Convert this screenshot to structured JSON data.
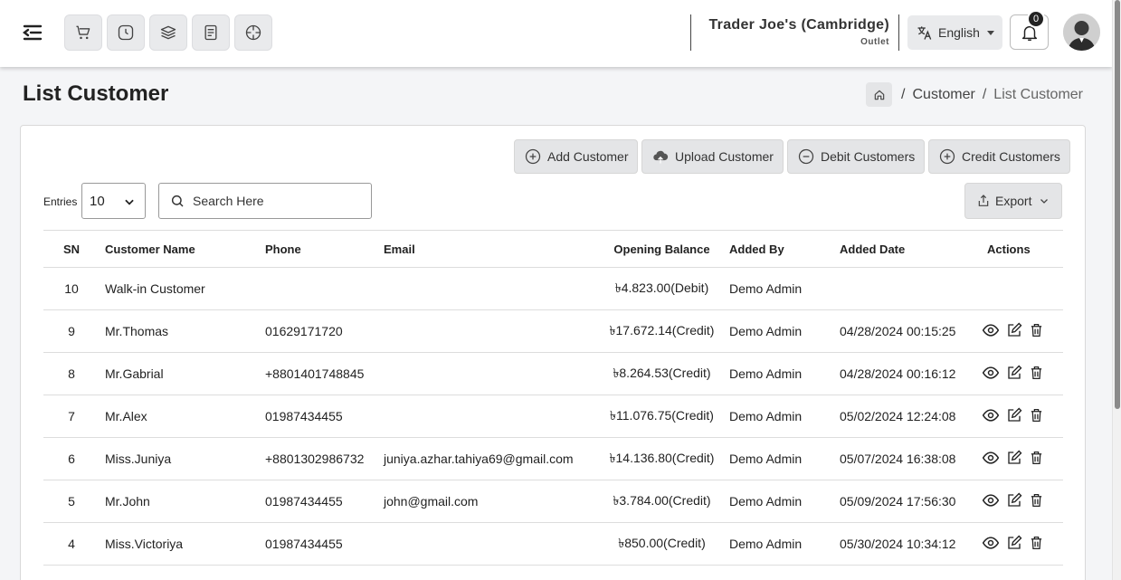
{
  "topbar": {
    "quick_icons": [
      "cart-icon",
      "clock-icon",
      "layers-icon",
      "receipt-icon",
      "dashboard-icon"
    ],
    "store_name": "Trader Joe's (Cambridge)",
    "store_type": "Outlet",
    "language": "English",
    "notification_count": "0"
  },
  "page": {
    "title": "List Customer",
    "breadcrumb": {
      "link": "Customer",
      "current": "List Customer",
      "sep1": "/",
      "sep2": "/"
    }
  },
  "actions": {
    "add": "Add Customer",
    "upload": "Upload Customer",
    "debit": "Debit Customers",
    "credit": "Credit Customers"
  },
  "filters": {
    "entries_label": "Entries",
    "entries_value": "10",
    "search_placeholder": "Search Here",
    "export_label": "Export"
  },
  "table": {
    "headers": {
      "sn": "SN",
      "name": "Customer Name",
      "phone": "Phone",
      "email": "Email",
      "balance": "Opening Balance",
      "added_by": "Added By",
      "added_date": "Added Date",
      "actions": "Actions"
    },
    "rows": [
      {
        "sn": "10",
        "name": "Walk-in Customer",
        "phone": "",
        "email": "",
        "balance": "৳4.823.00(Debit)",
        "added_by": "Demo Admin",
        "date": "",
        "actions": false
      },
      {
        "sn": "9",
        "name": "Mr.Thomas",
        "phone": "01629171720",
        "email": "",
        "balance": "৳17.672.14(Credit)",
        "added_by": "Demo Admin",
        "date": "04/28/2024 00:15:25",
        "actions": true
      },
      {
        "sn": "8",
        "name": "Mr.Gabrial",
        "phone": "+8801401748845",
        "email": "",
        "balance": "৳8.264.53(Credit)",
        "added_by": "Demo Admin",
        "date": "04/28/2024 00:16:12",
        "actions": true
      },
      {
        "sn": "7",
        "name": "Mr.Alex",
        "phone": "01987434455",
        "email": "",
        "balance": "৳11.076.75(Credit)",
        "added_by": "Demo Admin",
        "date": "05/02/2024 12:24:08",
        "actions": true
      },
      {
        "sn": "6",
        "name": "Miss.Juniya",
        "phone": "+8801302986732",
        "email": "juniya.azhar.tahiya69@gmail.com",
        "balance": "৳14.136.80(Credit)",
        "added_by": "Demo Admin",
        "date": "05/07/2024 16:38:08",
        "actions": true
      },
      {
        "sn": "5",
        "name": "Mr.John",
        "phone": "01987434455",
        "email": "john@gmail.com",
        "balance": "৳3.784.00(Credit)",
        "added_by": "Demo Admin",
        "date": "05/09/2024 17:56:30",
        "actions": true
      },
      {
        "sn": "4",
        "name": "Miss.Victoriya",
        "phone": "01987434455",
        "email": "",
        "balance": "৳850.00(Credit)",
        "added_by": "Demo Admin",
        "date": "05/30/2024 10:34:12",
        "actions": true
      }
    ]
  }
}
